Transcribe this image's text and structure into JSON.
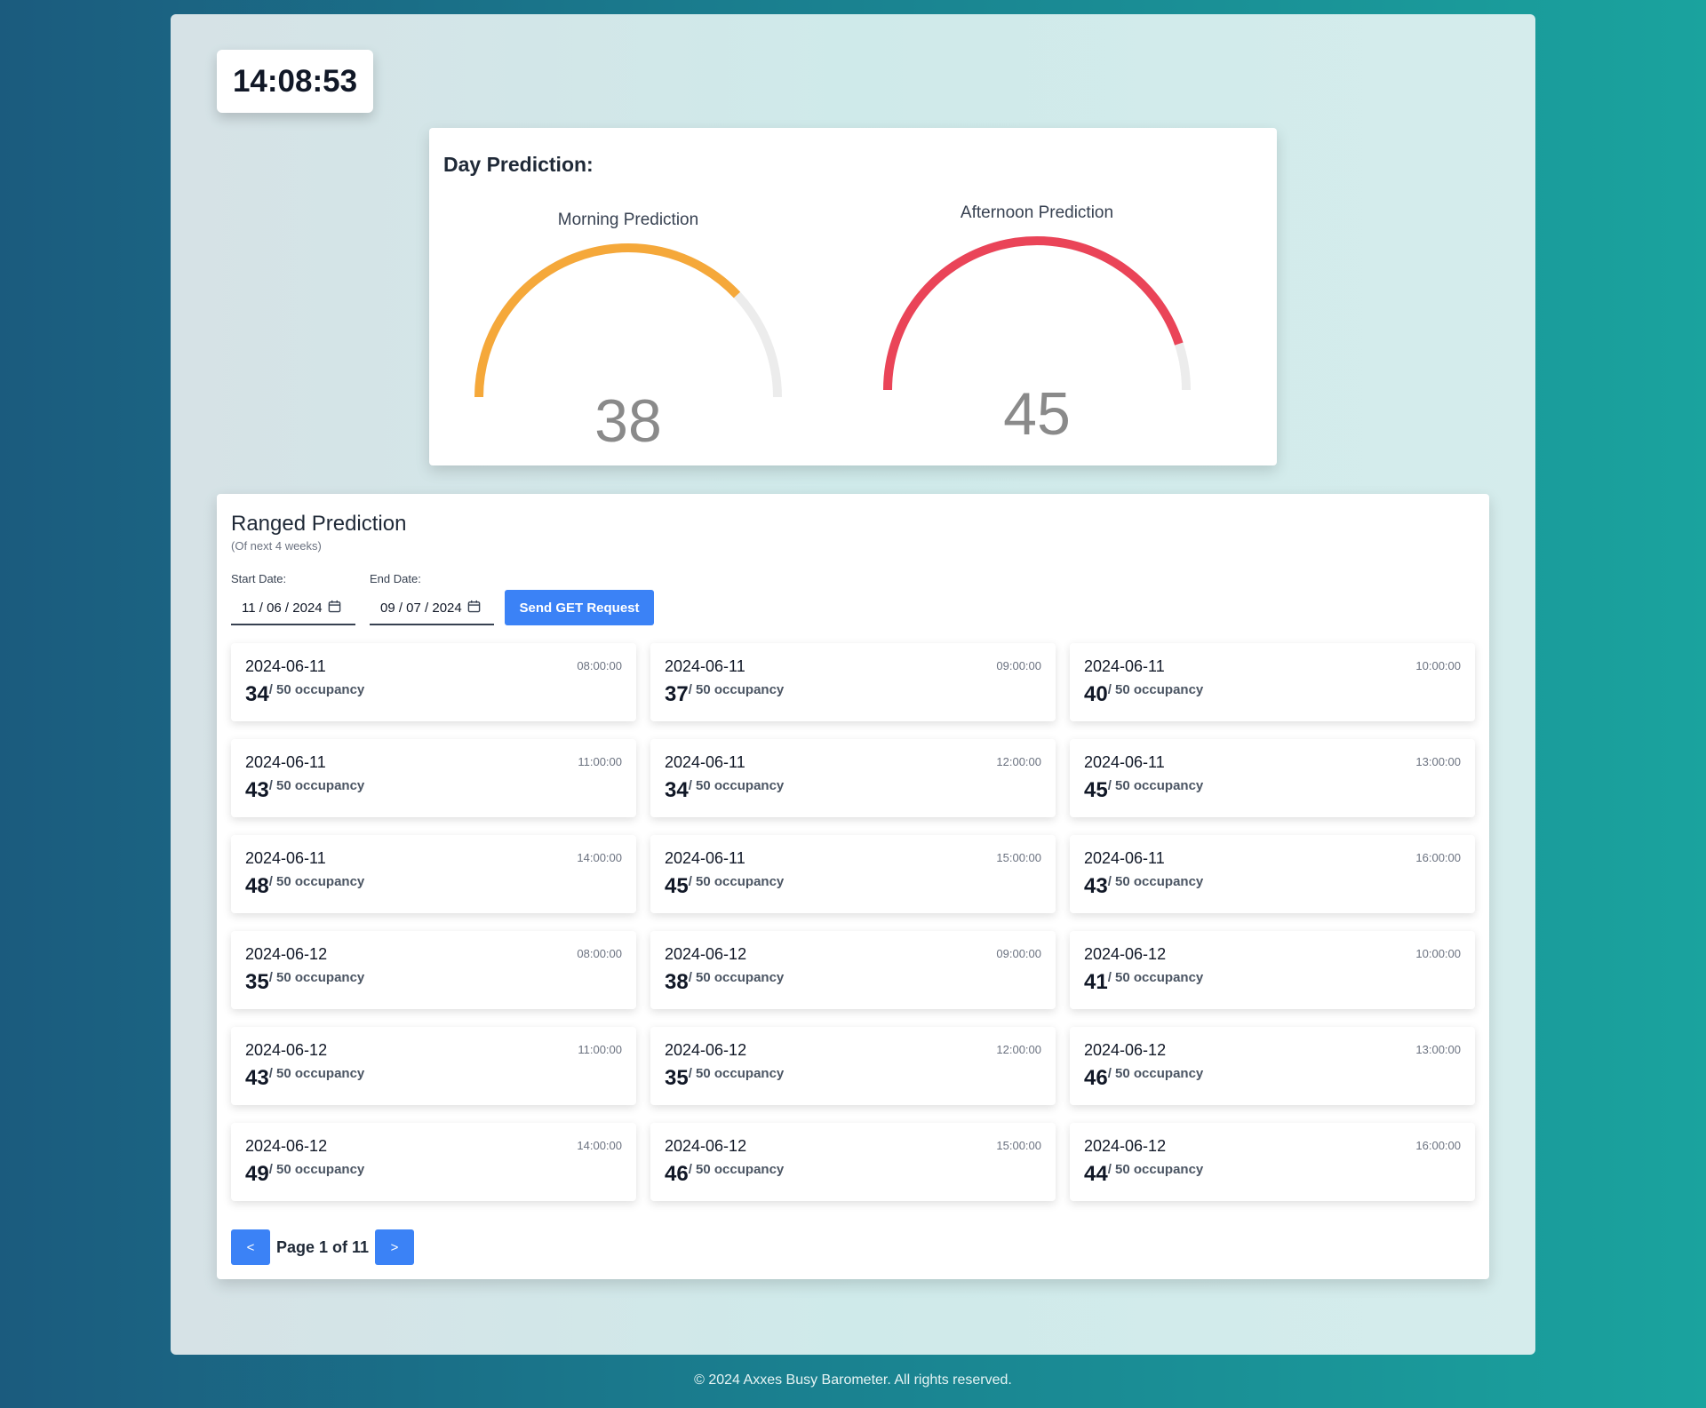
{
  "clock": {
    "time": "14:08:53"
  },
  "day_prediction": {
    "title": "Day Prediction:",
    "max_value": 50,
    "morning": {
      "label": "Morning Prediction",
      "value": 38,
      "color": "#f5a83a"
    },
    "afternoon": {
      "label": "Afternoon Prediction",
      "value": 45,
      "color": "#ea4458"
    },
    "track_color": "#ececec"
  },
  "ranged_prediction": {
    "title": "Ranged Prediction",
    "subtitle": "(Of next 4 weeks)",
    "start_label": "Start Date:",
    "start_value": "11 / 06 / 2024",
    "end_label": "End Date:",
    "end_value": "09 / 07 / 2024",
    "calendar_icon": "calendar-icon",
    "send_button": "Send GET Request",
    "capacity_text": "/ 50 occupancy",
    "slots": [
      {
        "date": "2024-06-11",
        "time": "08:00:00",
        "value": "34"
      },
      {
        "date": "2024-06-11",
        "time": "09:00:00",
        "value": "37"
      },
      {
        "date": "2024-06-11",
        "time": "10:00:00",
        "value": "40"
      },
      {
        "date": "2024-06-11",
        "time": "11:00:00",
        "value": "43"
      },
      {
        "date": "2024-06-11",
        "time": "12:00:00",
        "value": "34"
      },
      {
        "date": "2024-06-11",
        "time": "13:00:00",
        "value": "45"
      },
      {
        "date": "2024-06-11",
        "time": "14:00:00",
        "value": "48"
      },
      {
        "date": "2024-06-11",
        "time": "15:00:00",
        "value": "45"
      },
      {
        "date": "2024-06-11",
        "time": "16:00:00",
        "value": "43"
      },
      {
        "date": "2024-06-12",
        "time": "08:00:00",
        "value": "35"
      },
      {
        "date": "2024-06-12",
        "time": "09:00:00",
        "value": "38"
      },
      {
        "date": "2024-06-12",
        "time": "10:00:00",
        "value": "41"
      },
      {
        "date": "2024-06-12",
        "time": "11:00:00",
        "value": "43"
      },
      {
        "date": "2024-06-12",
        "time": "12:00:00",
        "value": "35"
      },
      {
        "date": "2024-06-12",
        "time": "13:00:00",
        "value": "46"
      },
      {
        "date": "2024-06-12",
        "time": "14:00:00",
        "value": "49"
      },
      {
        "date": "2024-06-12",
        "time": "15:00:00",
        "value": "46"
      },
      {
        "date": "2024-06-12",
        "time": "16:00:00",
        "value": "44"
      }
    ],
    "pagination": {
      "prev": "<",
      "text": "Page 1 of 11",
      "next": ">"
    }
  },
  "footer": {
    "text": "© 2024 Axxes Busy Barometer. All rights reserved."
  },
  "colors": {
    "accent": "#3b82f6"
  }
}
